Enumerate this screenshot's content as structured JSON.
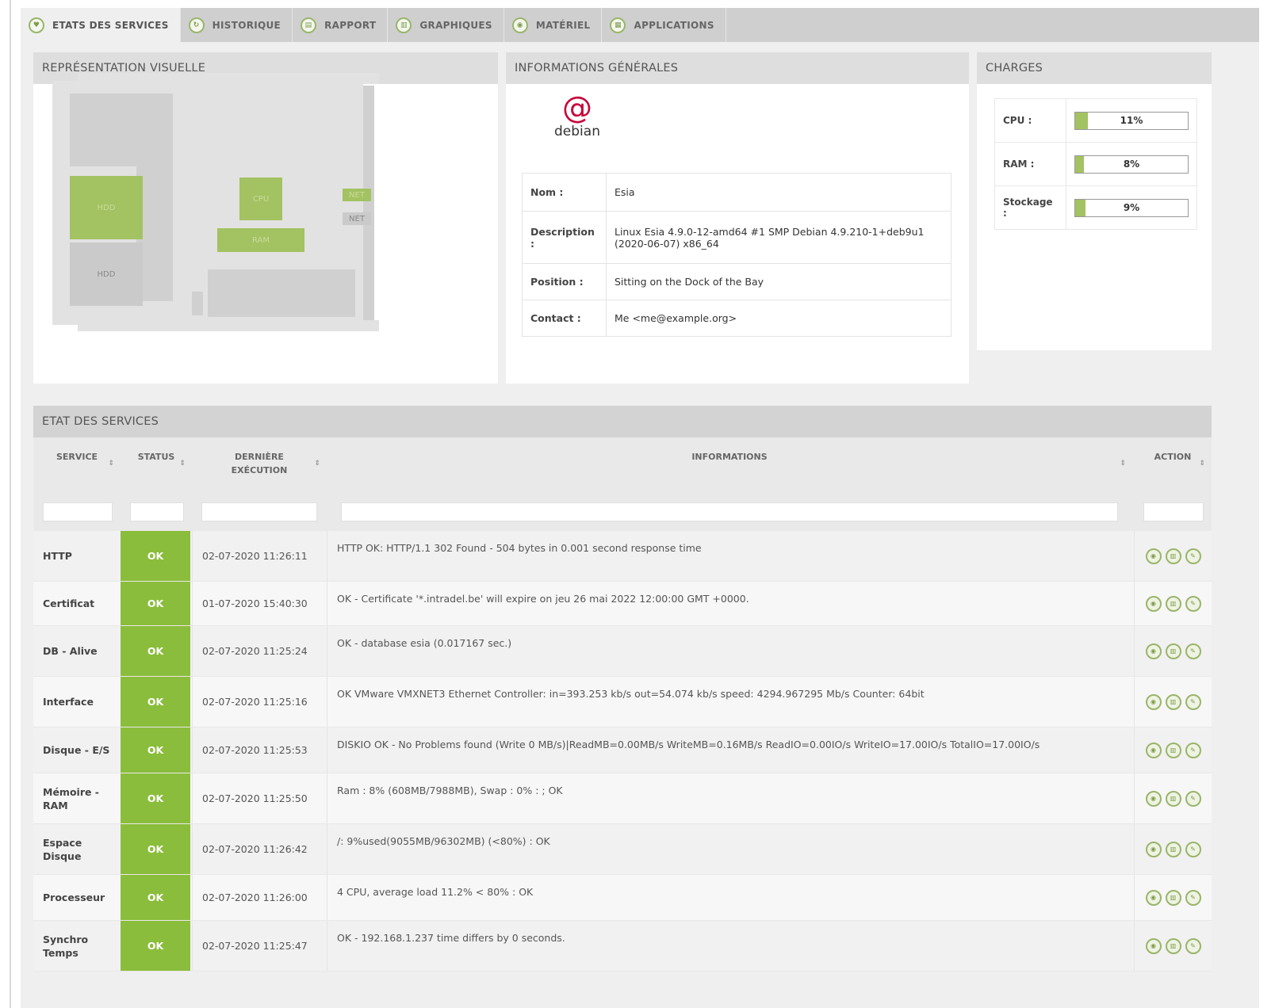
{
  "tabs": [
    {
      "label": "ETATS DES SERVICES",
      "icon": "heart-icon"
    },
    {
      "label": "HISTORIQUE",
      "icon": "history-icon"
    },
    {
      "label": "RAPPORT",
      "icon": "report-icon"
    },
    {
      "label": "GRAPHIQUES",
      "icon": "chart-icon"
    },
    {
      "label": "MATÉRIEL",
      "icon": "hardware-icon"
    },
    {
      "label": "APPLICATIONS",
      "icon": "apps-icon"
    }
  ],
  "visual": {
    "title": "REPRÉSENTATION VISUELLE",
    "labels": {
      "hdd1": "HDD",
      "hdd2": "HDD",
      "cpu": "CPU",
      "ram": "RAM",
      "net1": "NET",
      "net2": "NET"
    }
  },
  "general": {
    "title": "INFORMATIONS GÉNÉRALES",
    "logo_text": "debian",
    "rows": [
      {
        "key": "Nom :",
        "value": "Esia"
      },
      {
        "key": "Description :",
        "value": "Linux Esia 4.9.0-12-amd64 #1 SMP Debian 4.9.210-1+deb9u1 (2020-06-07) x86_64"
      },
      {
        "key": "Position :",
        "value": "Sitting on the Dock of the Bay"
      },
      {
        "key": "Contact :",
        "value": "Me <me@example.org>"
      }
    ]
  },
  "charges": {
    "title": "CHARGES",
    "items": [
      {
        "label": "CPU :",
        "value": "11%",
        "fraction": 0.11
      },
      {
        "label": "RAM :",
        "value": "8%",
        "fraction": 0.08
      },
      {
        "label": "Stockage :",
        "value": "9%",
        "fraction": 0.09
      }
    ]
  },
  "services": {
    "title": "ETAT DES SERVICES",
    "headers": {
      "service": "SERVICE",
      "status": "STATUS",
      "last_exec_1": "DERNIÈRE",
      "last_exec_2": "EXÉCUTION",
      "info": "INFORMATIONS",
      "action": "ACTION"
    },
    "sort_icon": "⇕",
    "rows": [
      {
        "name": "HTTP",
        "status": "OK",
        "date": "02-07-2020 11:26:11",
        "info": "HTTP OK: HTTP/1.1 302 Found - 504 bytes in 0.001 second response time"
      },
      {
        "name": "Certificat",
        "status": "OK",
        "date": "01-07-2020 15:40:30",
        "info": "OK - Certificate '*.intradel.be' will expire on jeu 26 mai 2022 12:00:00 GMT +0000."
      },
      {
        "name": "DB - Alive",
        "status": "OK",
        "date": "02-07-2020 11:25:24",
        "info": "OK - database esia (0.017167 sec.)"
      },
      {
        "name": "Interface",
        "status": "OK",
        "date": "02-07-2020 11:25:16",
        "info": "OK VMware VMXNET3 Ethernet Controller: in=393.253 kb/s out=54.074 kb/s speed: 4294.967295 Mb/s Counter: 64bit"
      },
      {
        "name": "Disque - E/S",
        "status": "OK",
        "date": "02-07-2020 11:25:53",
        "info": "DISKIO OK - No Problems found (Write 0 MB/s)|ReadMB=0.00MB/s WriteMB=0.16MB/s ReadIO=0.00IO/s WriteIO=17.00IO/s TotalIO=17.00IO/s"
      },
      {
        "name": "Mémoire - RAM",
        "status": "OK",
        "date": "02-07-2020 11:25:50",
        "info": "Ram : 8% (608MB/7988MB), Swap : 0% : ; OK"
      },
      {
        "name": "Espace Disque",
        "status": "OK",
        "date": "02-07-2020 11:26:42",
        "info": "/: 9%used(9055MB/96302MB) (<80%) : OK"
      },
      {
        "name": "Processeur",
        "status": "OK",
        "date": "02-07-2020 11:26:00",
        "info": "4 CPU, average load 11.2% < 80% : OK"
      },
      {
        "name": "Synchro Temps",
        "status": "OK",
        "date": "02-07-2020 11:25:47",
        "info": "OK - 192.168.1.237 time differs by 0 seconds."
      }
    ],
    "action_icons": [
      "status-icon",
      "graph-icon",
      "edit-icon"
    ]
  },
  "colors": {
    "accent": "#a3c262",
    "ok": "#8bbd3c",
    "debian": "#c7053b"
  }
}
